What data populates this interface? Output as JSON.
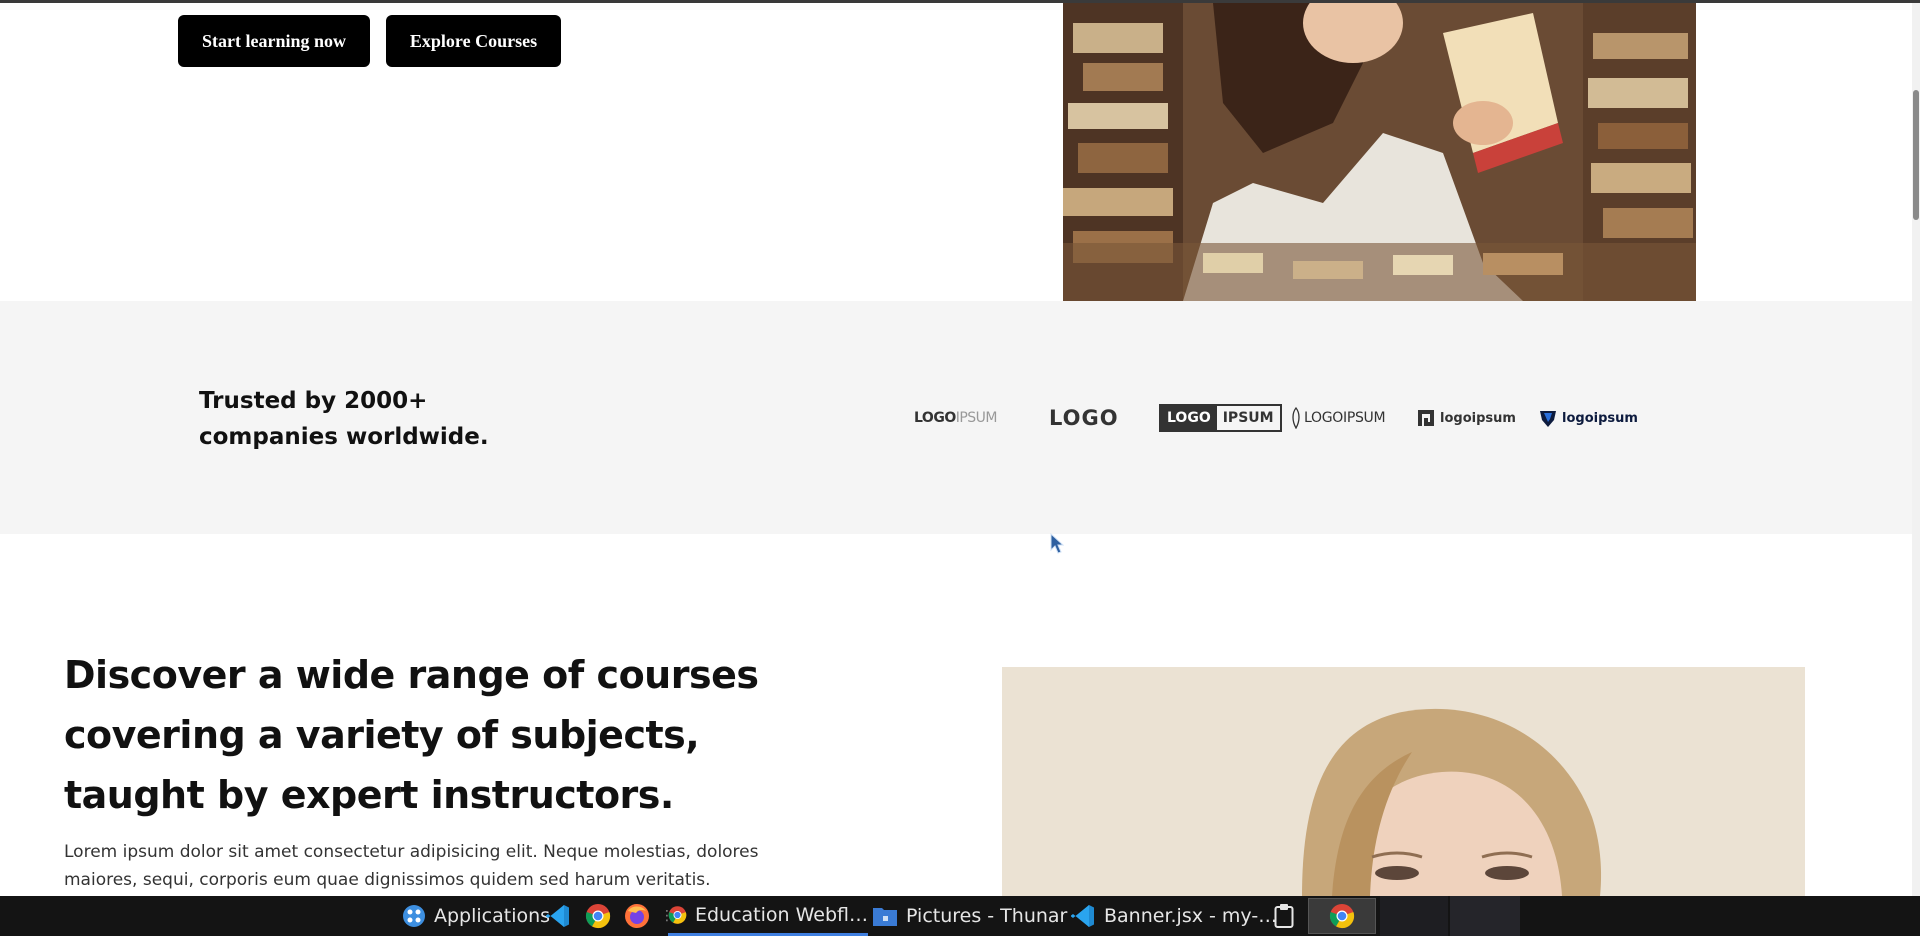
{
  "hero": {
    "start_label": "Start learning now",
    "explore_label": "Explore Courses"
  },
  "trusted": {
    "text": "Trusted by 2000+ companies worldwide.",
    "logos": [
      {
        "bold": "LOGO",
        "light": "IPSUM"
      },
      {
        "text": "LOGO"
      },
      {
        "dark": "LOGO",
        "light": "IPSUM"
      },
      {
        "text": "LOGOIPSUM"
      },
      {
        "text": "logoipsum"
      },
      {
        "text": "logoipsum"
      }
    ]
  },
  "discover": {
    "title": "Discover a wide range of courses covering a variety of subjects, taught by expert instructors.",
    "body": "Lorem ipsum dolor sit amet consectetur adipisicing elit. Neque molestias, dolores maiores, sequi, corporis eum quae dignissimos quidem sed harum veritatis."
  },
  "taskbar": {
    "applications": "Applications",
    "education": "Education Webfl…",
    "pictures": "Pictures - Thunar",
    "banner": "Banner.jsx - my-…"
  },
  "colors": {
    "button_bg": "#000000",
    "trusted_bg": "#f5f5f5",
    "taskbar_bg": "#141414",
    "active_underline": "#3f7fe0"
  }
}
